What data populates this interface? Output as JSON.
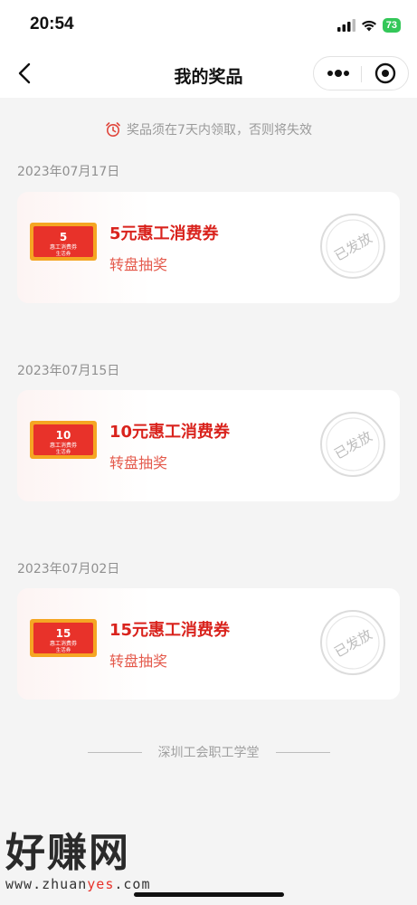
{
  "status_bar": {
    "time": "20:54",
    "battery": "73"
  },
  "nav": {
    "title": "我的奖品"
  },
  "notice": {
    "text": "奖品须在7天内领取，否则将失效"
  },
  "prizes": [
    {
      "date": "2023年07月17日",
      "name": "5元惠工消费券",
      "source": "转盘抽奖",
      "status": "已发放",
      "coupon_value": "5",
      "coupon_line1": "惠工消费券",
      "coupon_line2": "生活券"
    },
    {
      "date": "2023年07月15日",
      "name": "10元惠工消费券",
      "source": "转盘抽奖",
      "status": "已发放",
      "coupon_value": "10",
      "coupon_line1": "惠工消费券",
      "coupon_line2": "生活券"
    },
    {
      "date": "2023年07月02日",
      "name": "15元惠工消费券",
      "source": "转盘抽奖",
      "status": "已发放",
      "coupon_value": "15",
      "coupon_line1": "惠工消费券",
      "coupon_line2": "生活券"
    }
  ],
  "footer": {
    "text": "深圳工会职工学堂"
  },
  "watermark": {
    "main": "好赚网",
    "url_prefix": "www.zhuan",
    "url_highlight": "yes",
    "url_suffix": ".com"
  },
  "colors": {
    "accent": "#d9231d",
    "coupon_orange": "#f5a623",
    "background": "#f4f4f4"
  }
}
